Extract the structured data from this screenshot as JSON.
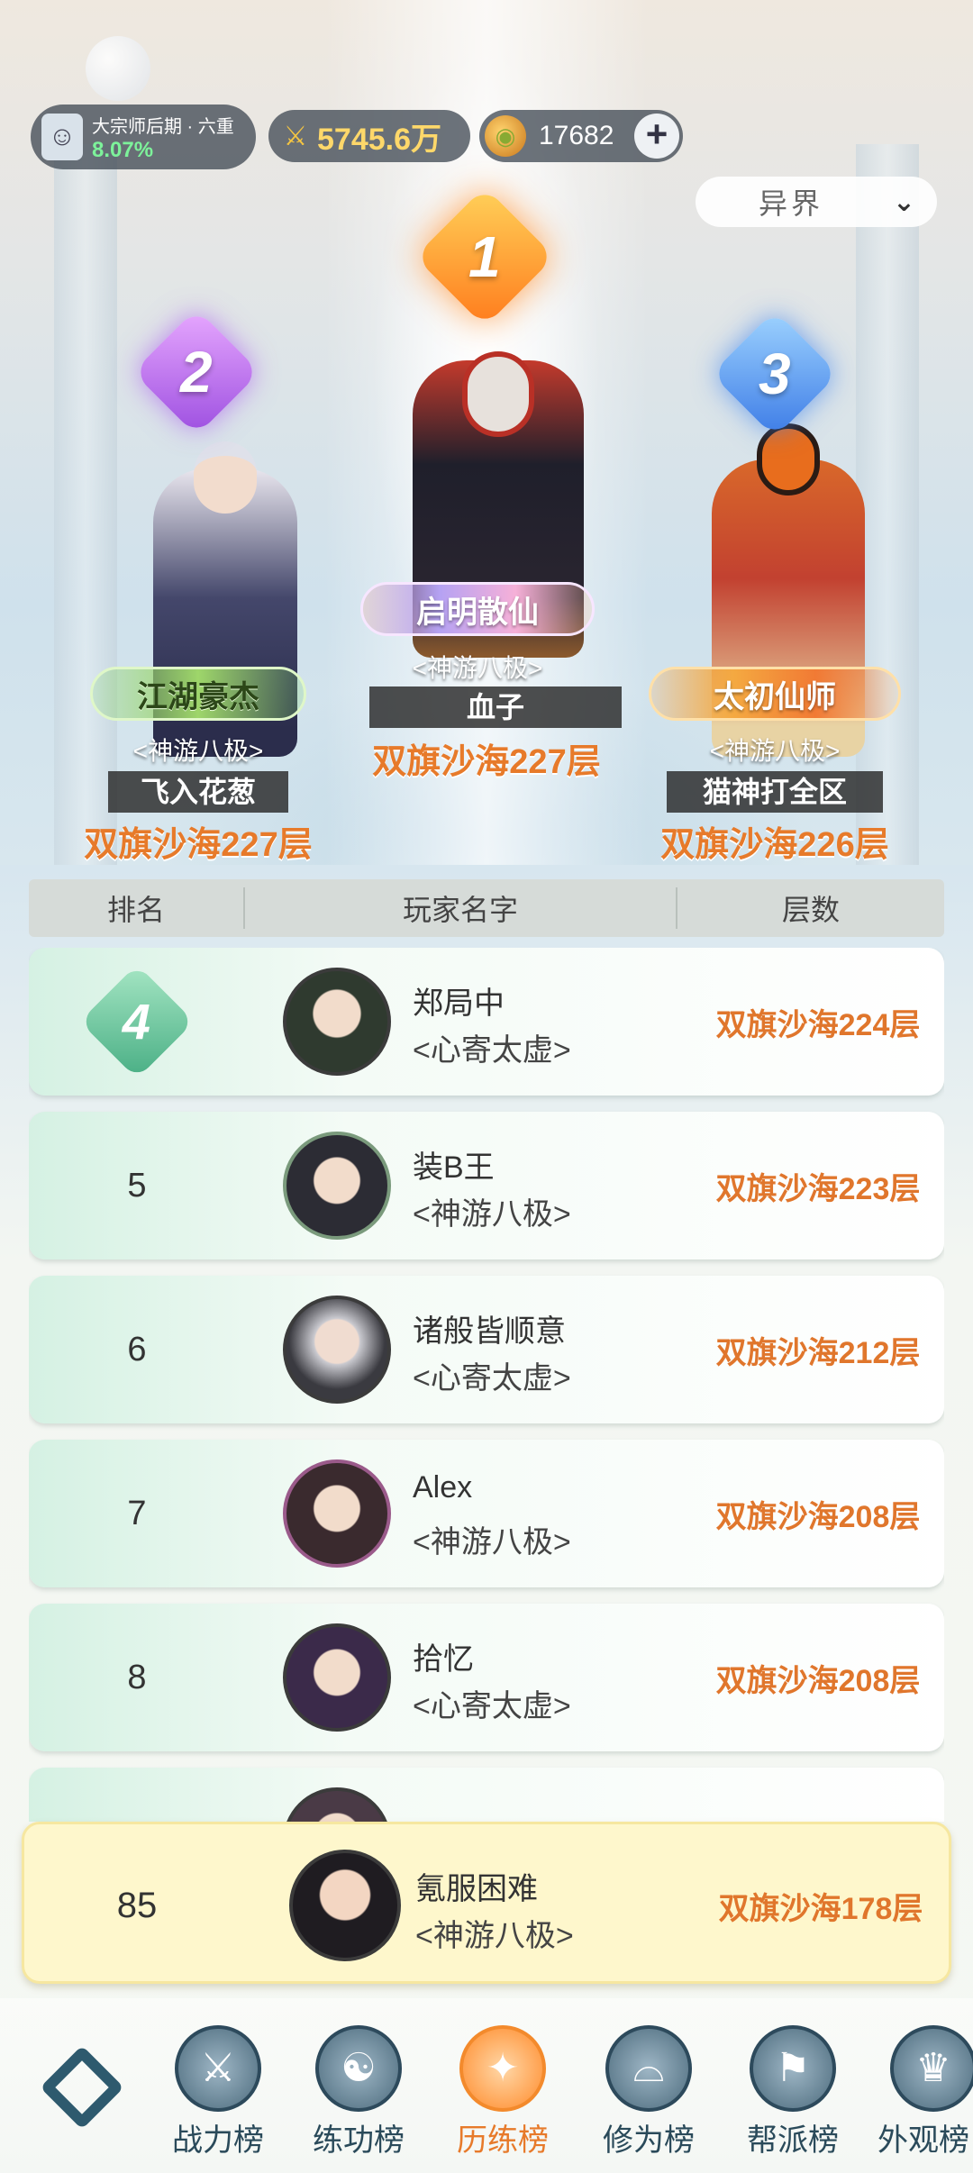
{
  "status": {
    "cultivation": "大宗师后期 · 六重",
    "progress": "8.07%",
    "power": "5745.6万",
    "coins": "17682",
    "add_symbol": "+"
  },
  "realm_filter": {
    "selected": "异界"
  },
  "podium": [
    {
      "rank": "1",
      "title": "启明散仙",
      "guild": "<神游八极>",
      "name": "血子",
      "floor": "双旗沙海227层"
    },
    {
      "rank": "2",
      "title": "江湖豪杰",
      "guild": "<神游八极>",
      "name": "飞入花葱",
      "floor": "双旗沙海227层"
    },
    {
      "rank": "3",
      "title": "太初仙师",
      "guild": "<神游八极>",
      "name": "猫神打全区",
      "floor": "双旗沙海226层"
    }
  ],
  "table": {
    "headers": [
      "排名",
      "玩家名字",
      "层数"
    ],
    "rows": [
      {
        "rank": "4",
        "name": "郑局中",
        "guild": "<心寄太虚>",
        "floor": "双旗沙海224层",
        "avatar_color": "#2f3a2f"
      },
      {
        "rank": "5",
        "name": "装B王",
        "guild": "<神游八极>",
        "floor": "双旗沙海223层",
        "avatar_color": "#2c2c34"
      },
      {
        "rank": "6",
        "name": "诸般皆顺意",
        "guild": "<心寄太虚>",
        "floor": "双旗沙海212层",
        "avatar_color": "#c9c9cf"
      },
      {
        "rank": "7",
        "name": "Alex",
        "guild": "<神游八极>",
        "floor": "双旗沙海208层",
        "avatar_color": "#3a2a2e"
      },
      {
        "rank": "8",
        "name": "拾忆",
        "guild": "<心寄太虚>",
        "floor": "双旗沙海208层",
        "avatar_color": "#3b2a4a"
      },
      {
        "rank": "",
        "name": "",
        "guild": "",
        "floor": "",
        "avatar_color": "#4a3a46"
      }
    ]
  },
  "me": {
    "rank": "85",
    "name": "氪服困难",
    "guild": "<神游八极>",
    "floor": "双旗沙海178层"
  },
  "nav": [
    {
      "label": "战力榜",
      "icon": "sword-icon"
    },
    {
      "label": "练功榜",
      "icon": "yin-yang-icon"
    },
    {
      "label": "历练榜",
      "icon": "star-icon"
    },
    {
      "label": "修为榜",
      "icon": "hat-icon"
    },
    {
      "label": "帮派榜",
      "icon": "banner-icon"
    },
    {
      "label": "外观榜",
      "icon": "costume-icon"
    }
  ],
  "nav_active": "历练榜"
}
